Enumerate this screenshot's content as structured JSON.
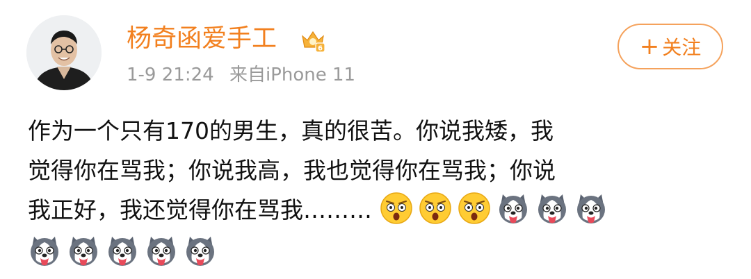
{
  "user": {
    "name": "杨奇函爱手工",
    "badge_icon": "vip-crown-icon",
    "badge_level": "6",
    "avatar": "avatar-photo"
  },
  "meta": {
    "time": "1-9 21:24",
    "source": "来自iPhone 11"
  },
  "follow_button": {
    "plus": "+",
    "label": "关注"
  },
  "post": {
    "lines": [
      "作为一个只有170的男生，真的很苦。你说我矮，我",
      "觉得你在骂我；你说我高，我也觉得你在骂我；你说",
      "我正好，我还觉得你在骂我………"
    ],
    "emojis": [
      "surprised-emoji",
      "surprised-emoji",
      "surprised-emoji",
      "husky-dog-emoji",
      "husky-dog-emoji",
      "husky-dog-emoji",
      "husky-dog-emoji",
      "husky-dog-emoji",
      "husky-dog-emoji",
      "husky-dog-emoji",
      "husky-dog-emoji"
    ]
  },
  "colors": {
    "accent": "#f2801f",
    "meta_gray": "#9a9a9a",
    "text": "#111111"
  }
}
